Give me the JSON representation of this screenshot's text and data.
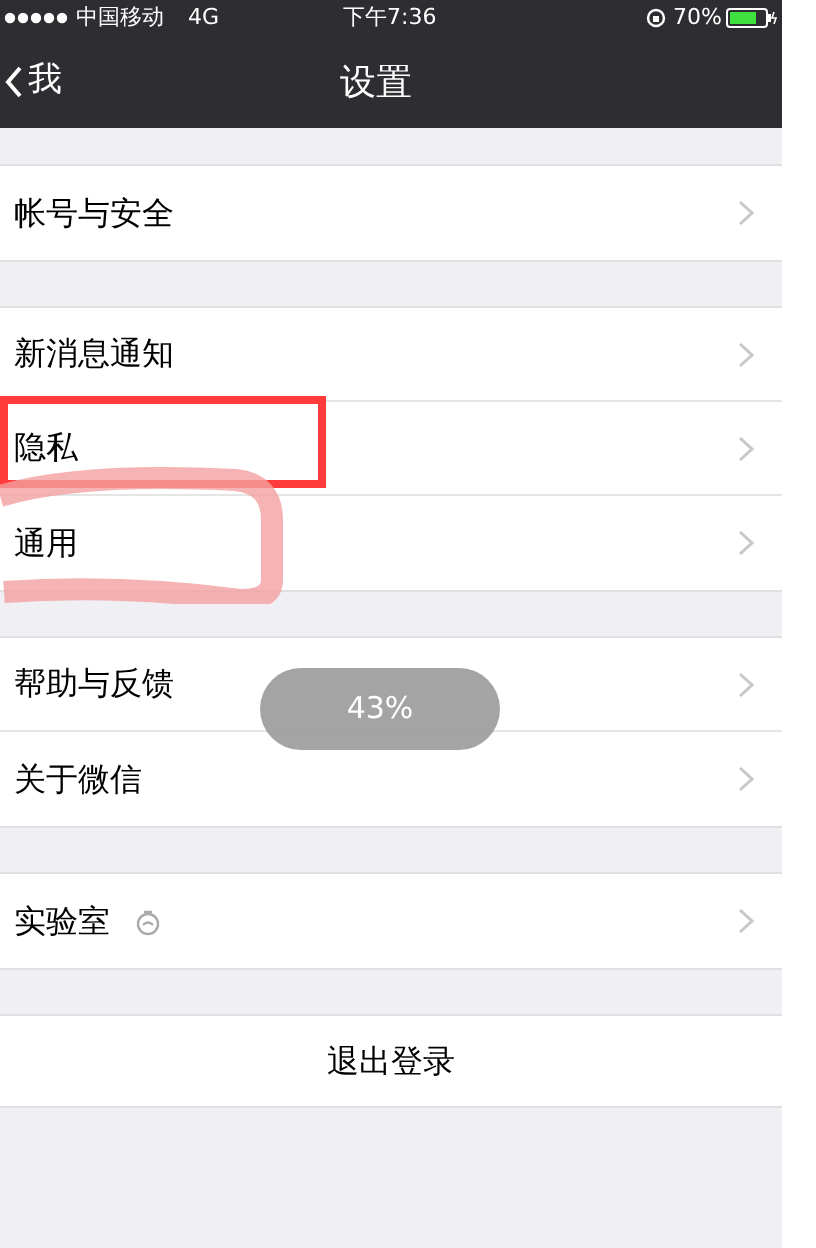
{
  "status_bar": {
    "carrier": "中国移动",
    "network": "4G",
    "time": "下午7:36",
    "battery": "70%"
  },
  "nav": {
    "back": "我",
    "title": "设置"
  },
  "groups": [
    [
      {
        "label": "帐号与安全",
        "kind": "plain"
      }
    ],
    [
      {
        "label": "新消息通知",
        "kind": "plain"
      },
      {
        "label": "隐私",
        "kind": "plain"
      },
      {
        "label": "通用",
        "kind": "plain"
      }
    ],
    [
      {
        "label": "帮助与反馈",
        "kind": "plain"
      },
      {
        "label": "关于微信",
        "kind": "plain"
      }
    ],
    [
      {
        "label": "实验室",
        "kind": "with_icon"
      }
    ]
  ],
  "logout": "退出登录",
  "toast": "43%",
  "annotations": [
    {
      "kind": "box"
    },
    {
      "kind": "scribble"
    }
  ]
}
